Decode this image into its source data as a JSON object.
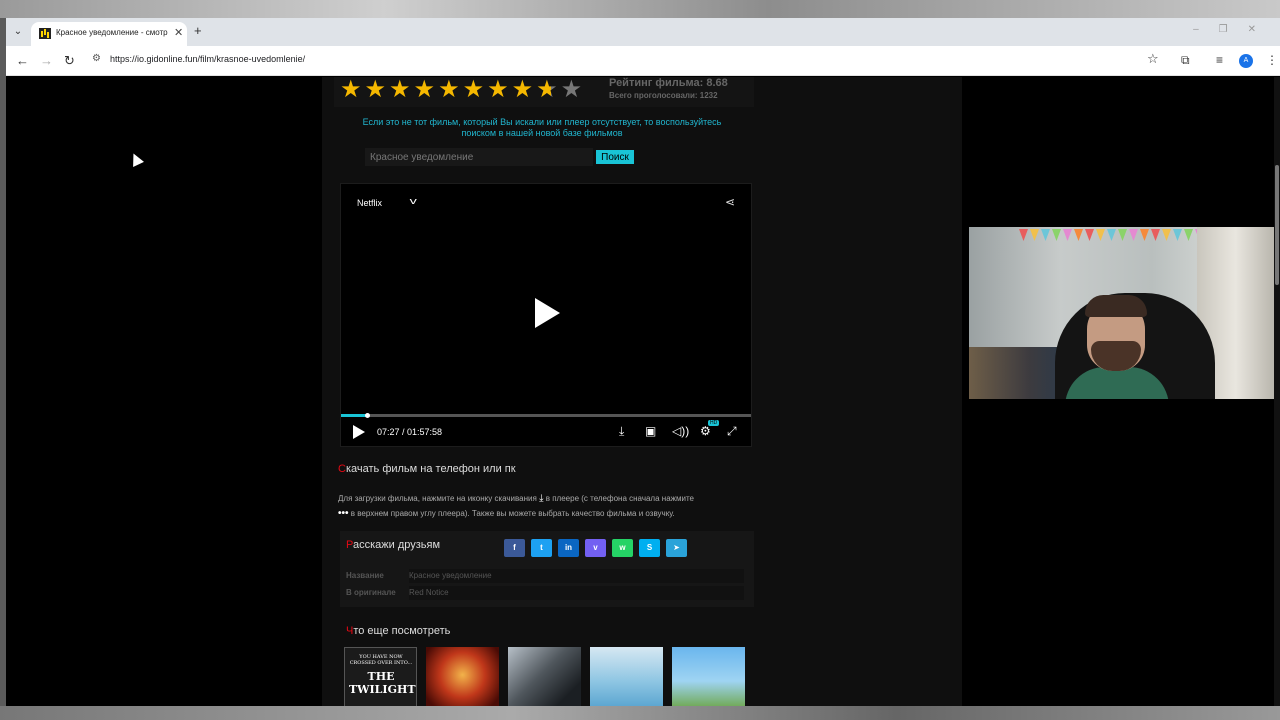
{
  "tab": {
    "title": "Красное уведомление - смотр",
    "close_icon": "close-icon",
    "new_tab_icon": "plus-icon"
  },
  "address_bar": {
    "url": "https://io.gidonline.fun/film/krasnoe-uvedomlenie/"
  },
  "profile": {
    "initial": "A",
    "color": "#1a73e8"
  },
  "rating": {
    "value": 8.68,
    "max": 10,
    "label": "Рейтинг фильма: 8.68",
    "votes": "Всего проголосовали: 1232",
    "star_color": "#f5b800"
  },
  "notice": {
    "line1": "Если это не тот фильм, который Вы искали или плеер отсутствует, то воспользуйтесь",
    "line2": "поиском в нашей новой базе фильмов"
  },
  "search": {
    "value": "Красное уведомление",
    "button": "Поиск"
  },
  "player": {
    "provider": "Netflix",
    "time": "07:27 / 01:57:58",
    "progress": 0.063,
    "quality_badge": "HD",
    "accent": "#19c4d6"
  },
  "download": {
    "heading_first": "С",
    "heading_rest": "качать фильм на телефон или пк",
    "text_part1": "Для загрузки фильма, нажмите на иконку скачивания",
    "text_part2": "в плеере (с телефона сначала нажмите",
    "text_part3": "в верхнем правом углу плеера). Также вы можете выбрать качество фильма и озвучку."
  },
  "share": {
    "heading_first": "Р",
    "heading_rest": "асскажи друзьям",
    "networks": [
      {
        "name": "facebook",
        "glyph": "f",
        "color": "#3b5998"
      },
      {
        "name": "twitter",
        "glyph": "t",
        "color": "#1da1f2"
      },
      {
        "name": "linkedin",
        "glyph": "in",
        "color": "#0a66c2"
      },
      {
        "name": "viber",
        "glyph": "v",
        "color": "#7360f2"
      },
      {
        "name": "whatsapp",
        "glyph": "w",
        "color": "#25d366"
      },
      {
        "name": "skype",
        "glyph": "S",
        "color": "#00aff0"
      },
      {
        "name": "telegram",
        "glyph": "➤",
        "color": "#2aa3d9"
      }
    ]
  },
  "info": {
    "title_label": "Название",
    "title_value": "Красное уведомление",
    "original_label": "В оригинале",
    "original_value": "Red Notice"
  },
  "recommendations": {
    "heading_first": "Ч",
    "heading_rest": "то еще посмотреть",
    "twilight_line1": "YOU HAVE NOW CROSSED OVER INTO...",
    "twilight_line2": "THE TWILIGHT"
  }
}
